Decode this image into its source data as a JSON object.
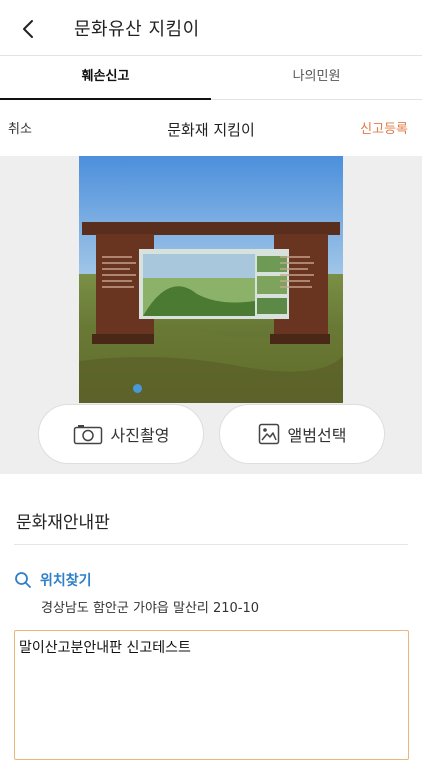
{
  "header": {
    "title": "문화유산 지킴이",
    "back_icon": "chevron-left-icon"
  },
  "tabs": [
    {
      "label": "훼손신고",
      "active": true
    },
    {
      "label": "나의민원",
      "active": false
    }
  ],
  "subheader": {
    "cancel_label": "취소",
    "title": "문화재 지킴이",
    "submit_label": "신고등록",
    "submit_color": "#e07b47"
  },
  "photo": {
    "carousel_index": 1,
    "carousel_count": 1
  },
  "actions": {
    "camera_label": "사진촬영",
    "camera_icon": "camera-icon",
    "album_label": "앨범선택",
    "album_icon": "gallery-icon"
  },
  "form": {
    "category_title": "문화재안내판",
    "location_label": "위치찾기",
    "location_icon": "search-icon",
    "address": "경상남도 함안군 가야읍 말산리 210-10",
    "description_value": "말이산고분안내판 신고테스트"
  },
  "colors": {
    "accent_blue": "#2f7fc9",
    "accent_orange": "#e07b47",
    "focus_border": "#e9b779"
  }
}
